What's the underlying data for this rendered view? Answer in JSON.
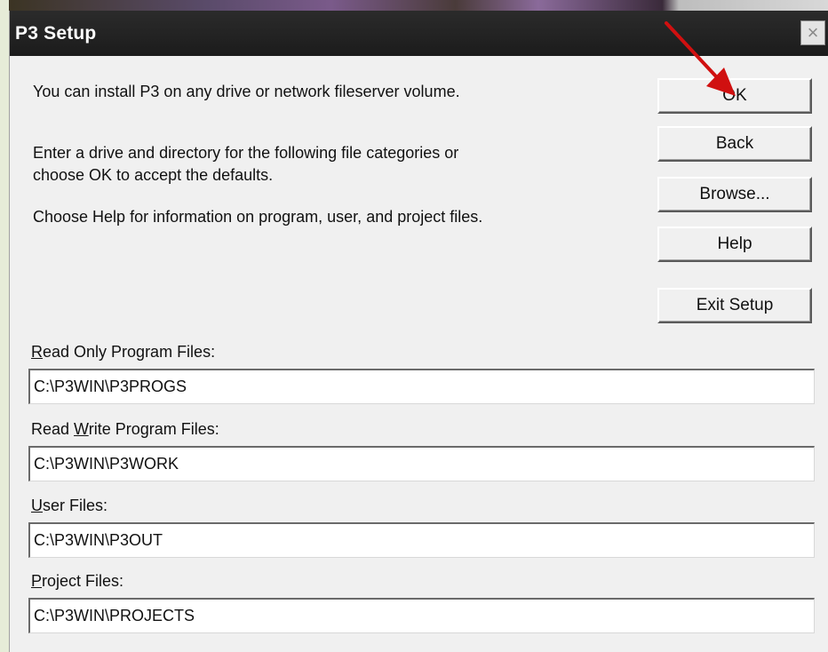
{
  "window": {
    "title": "P3 Setup",
    "close_glyph": "×"
  },
  "intro": {
    "line1": "You can install P3 on any drive or network fileserver volume.",
    "line2": "Enter a drive and directory for the following file categories or",
    "line3": "choose OK to accept the defaults.",
    "line4": "Choose Help for information on program, user, and project files."
  },
  "buttons": {
    "ok": "OK",
    "back": "Back",
    "browse": "Browse...",
    "help": "Help",
    "exit": "Exit Setup"
  },
  "fields": {
    "read_only": {
      "mnemonic": "R",
      "label_rest": "ead Only Program Files:",
      "value": "C:\\P3WIN\\P3PROGS"
    },
    "read_write": {
      "label_pre": "Read ",
      "mnemonic": "W",
      "label_rest": "rite Program Files:",
      "value": "C:\\P3WIN\\P3WORK"
    },
    "user": {
      "mnemonic": "U",
      "label_rest": "ser Files:",
      "value": "C:\\P3WIN\\P3OUT"
    },
    "project": {
      "mnemonic": "P",
      "label_rest": "roject Files:",
      "value": "C:\\P3WIN\\PROJECTS"
    }
  },
  "annotation": {
    "arrow_color": "#d01010"
  }
}
